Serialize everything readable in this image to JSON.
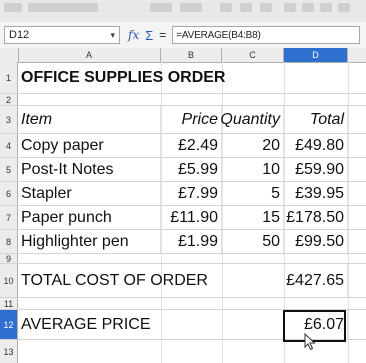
{
  "formula_bar": {
    "cell_ref": "D12",
    "formula": "=AVERAGE(B4:B8)"
  },
  "columns": [
    "A",
    "B",
    "C",
    "D"
  ],
  "selected_column": "D",
  "row_numbers": [
    "1",
    "2",
    "3",
    "4",
    "5",
    "6",
    "7",
    "8",
    "9",
    "10",
    "11",
    "12",
    "13"
  ],
  "selected_row": "12",
  "sheet": {
    "title": "OFFICE SUPPLIES ORDER",
    "headers": {
      "item": "Item",
      "price": "Price",
      "quantity": "Quantity",
      "total": "Total"
    },
    "items": [
      {
        "item": "Copy paper",
        "price": "£2.49",
        "quantity": "20",
        "total": "£49.80"
      },
      {
        "item": "Post-It Notes",
        "price": "£5.99",
        "quantity": "10",
        "total": "£59.90"
      },
      {
        "item": "Stapler",
        "price": "£7.99",
        "quantity": "5",
        "total": "£39.95"
      },
      {
        "item": "Paper punch",
        "price": "£11.90",
        "quantity": "15",
        "total": "£178.50"
      },
      {
        "item": "Highlighter pen",
        "price": "£1.99",
        "quantity": "50",
        "total": "£99.50"
      }
    ],
    "total_label": "TOTAL COST OF ORDER",
    "total_value": "£427.65",
    "average_label": "AVERAGE PRICE",
    "average_value": "£6.07"
  },
  "colors": {
    "selection": "#2f6fcf",
    "icon_accent": "#2a5ab8"
  },
  "icons": {
    "fx": "function-wizard-icon",
    "sigma": "sum-icon",
    "cursor": "mouse-pointer-icon"
  }
}
